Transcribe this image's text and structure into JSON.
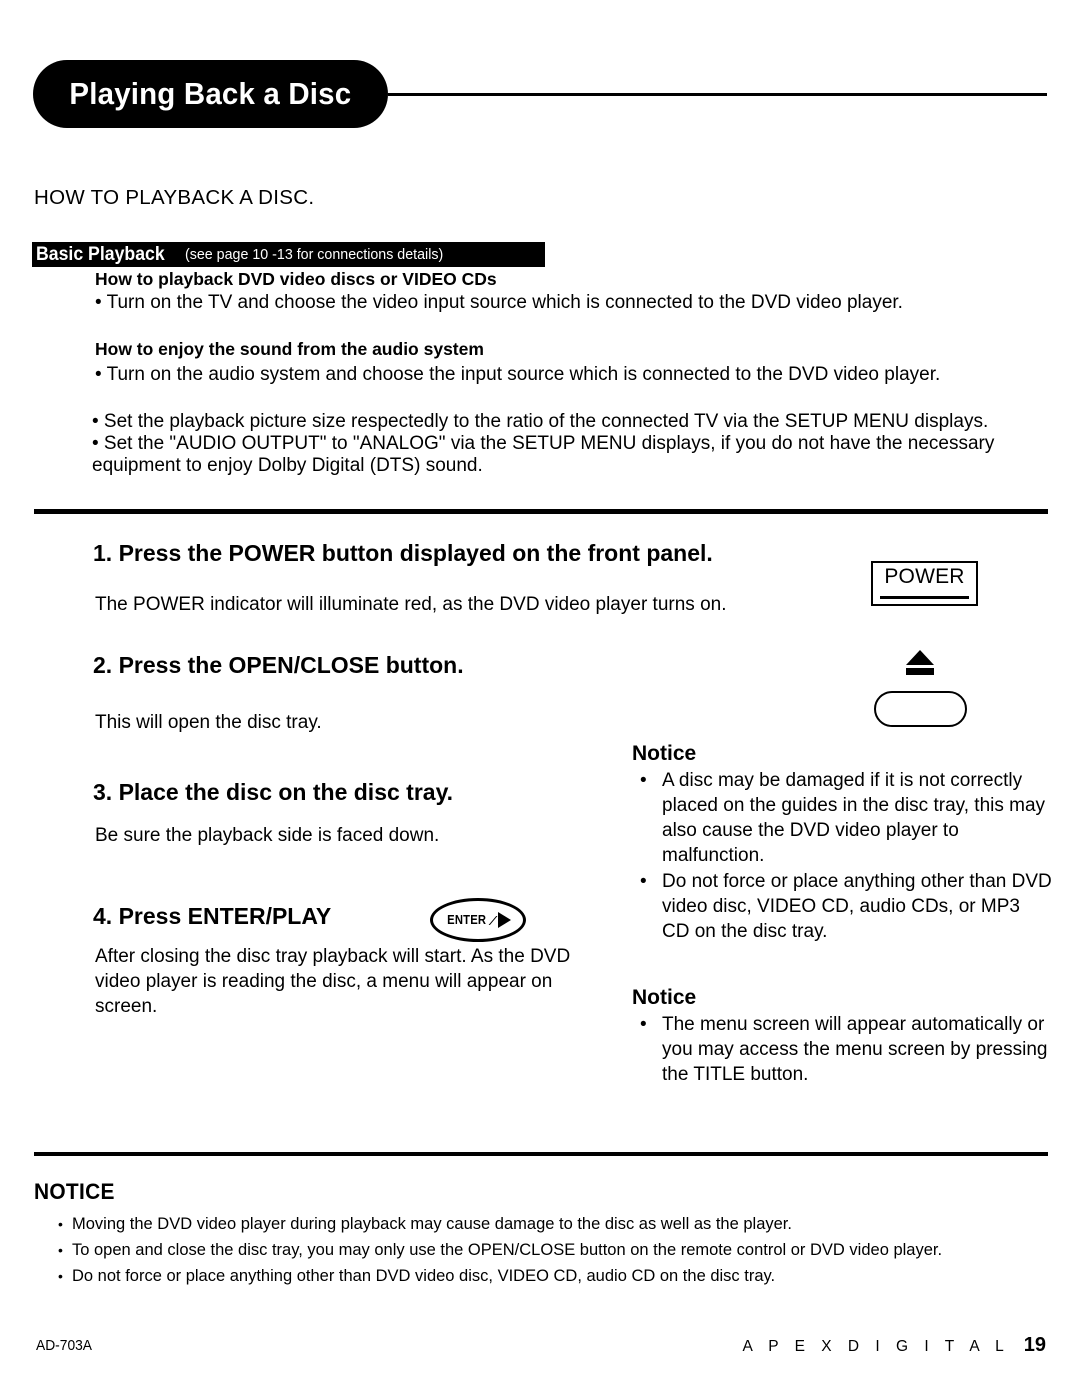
{
  "header": {
    "title": "Playing Back a Disc"
  },
  "section": {
    "how_to": "HOW TO PLAYBACK A DISC."
  },
  "basic_playback": {
    "bar_title": "Basic Playback",
    "bar_note": "(see page 10 -13 for connections details)",
    "sub1": "How to playback DVD video discs or VIDEO CDs",
    "line1": "• Turn on the TV and choose the video input source which is connected to the DVD video player.",
    "sub2": "How to enjoy the sound from the audio system",
    "line2": "• Turn on the audio system and  choose the input source which is connected to the DVD video player.",
    "line3": "• Set the playback picture size respectedly to the ratio of the connected TV via the SETUP MENU displays.",
    "line4": "• Set the \"AUDIO OUTPUT\" to \"ANALOG\" via the SETUP MENU displays, if you do not have the necessary equipment to enjoy Dolby Digital (DTS) sound."
  },
  "steps": [
    {
      "heading": "1. Press the POWER button displayed on the front panel.",
      "body": "The POWER indicator will illuminate red, as the DVD video player turns on."
    },
    {
      "heading": "2. Press the OPEN/CLOSE button.",
      "body": "This will open the disc tray."
    },
    {
      "heading": "3. Place the disc on the disc tray.",
      "body": "Be sure the playback side is faced down."
    },
    {
      "heading": "4. Press ENTER/PLAY",
      "body": "After closing the disc tray playback will start.\nAs the DVD video player is reading the disc, a menu will appear on screen."
    }
  ],
  "controls": {
    "power_label": "POWER",
    "enter_label": "ENTER",
    "enter_separator": "⁄"
  },
  "notices": [
    {
      "title": "Notice",
      "items": [
        "A disc may be damaged if it is not correctly placed on the guides in the disc tray, this may also cause the DVD video player to malfunction.",
        "Do not force or place anything other than DVD video disc, VIDEO CD, audio CDs, or MP3 CD on the disc tray."
      ]
    },
    {
      "title": "Notice",
      "items": [
        "The menu screen will appear automatically or you may access the menu screen by pressing the TITLE button."
      ]
    }
  ],
  "bottom_notice": {
    "title": "NOTICE",
    "items": [
      "Moving the DVD video player during playback may cause damage to the disc as well as the player.",
      "To open and close the disc tray, you may only use the OPEN/CLOSE button on the remote control or DVD video player.",
      "Do not force or place anything other than DVD video disc, VIDEO CD, audio CD on the disc tray."
    ]
  },
  "footer": {
    "model": "AD-703A",
    "brand": "A P E X   D I G I T A L",
    "page": "19"
  },
  "colors": {
    "ink": "#000000",
    "paper": "#ffffff"
  }
}
